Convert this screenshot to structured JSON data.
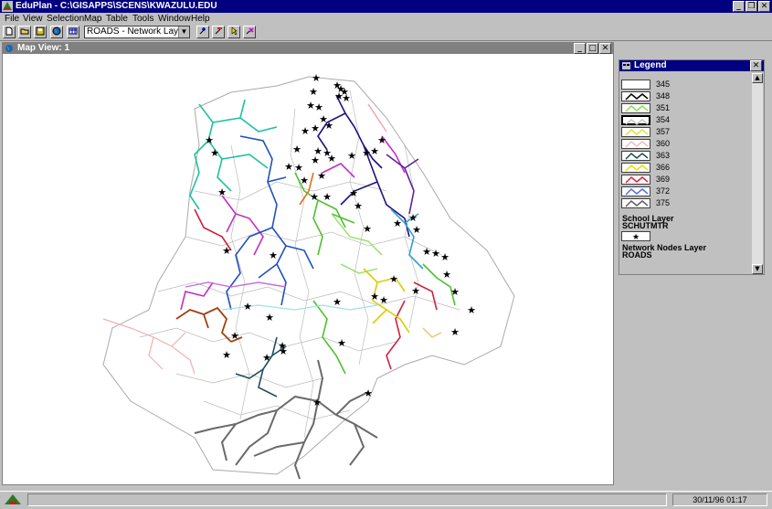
{
  "window": {
    "title": "EduPlan - C:\\GISAPPS\\SCENS\\KWAZULU.EDU"
  },
  "menu": [
    "File",
    "View",
    "Selection",
    "Map",
    "Table",
    "Tools",
    "Window",
    "Help"
  ],
  "toolbar": {
    "layer_value": "ROADS - Network Layer"
  },
  "map_window": {
    "title": "Map View: 1"
  },
  "legend": {
    "title": "Legend",
    "rows": [
      {
        "label": "345",
        "color": "#ffffff"
      },
      {
        "label": "348",
        "color": "#000000"
      },
      {
        "label": "351",
        "color": "#88e058"
      },
      {
        "label": "354",
        "color": "#c8c8c8"
      },
      {
        "label": "357",
        "color": "#e0e040"
      },
      {
        "label": "360",
        "color": "#f0c0c0"
      },
      {
        "label": "363",
        "color": "#205050"
      },
      {
        "label": "366",
        "color": "#e8e000"
      },
      {
        "label": "369",
        "color": "#e02040"
      },
      {
        "label": "372",
        "color": "#5070e0"
      },
      {
        "label": "375",
        "color": "#606060"
      }
    ],
    "school_layer": "School Layer",
    "school_name": "SCHUTMTR",
    "network_layer": "Network Nodes Layer",
    "network_name": "ROADS"
  },
  "status": {
    "datetime": "30/11/96  01:17"
  }
}
